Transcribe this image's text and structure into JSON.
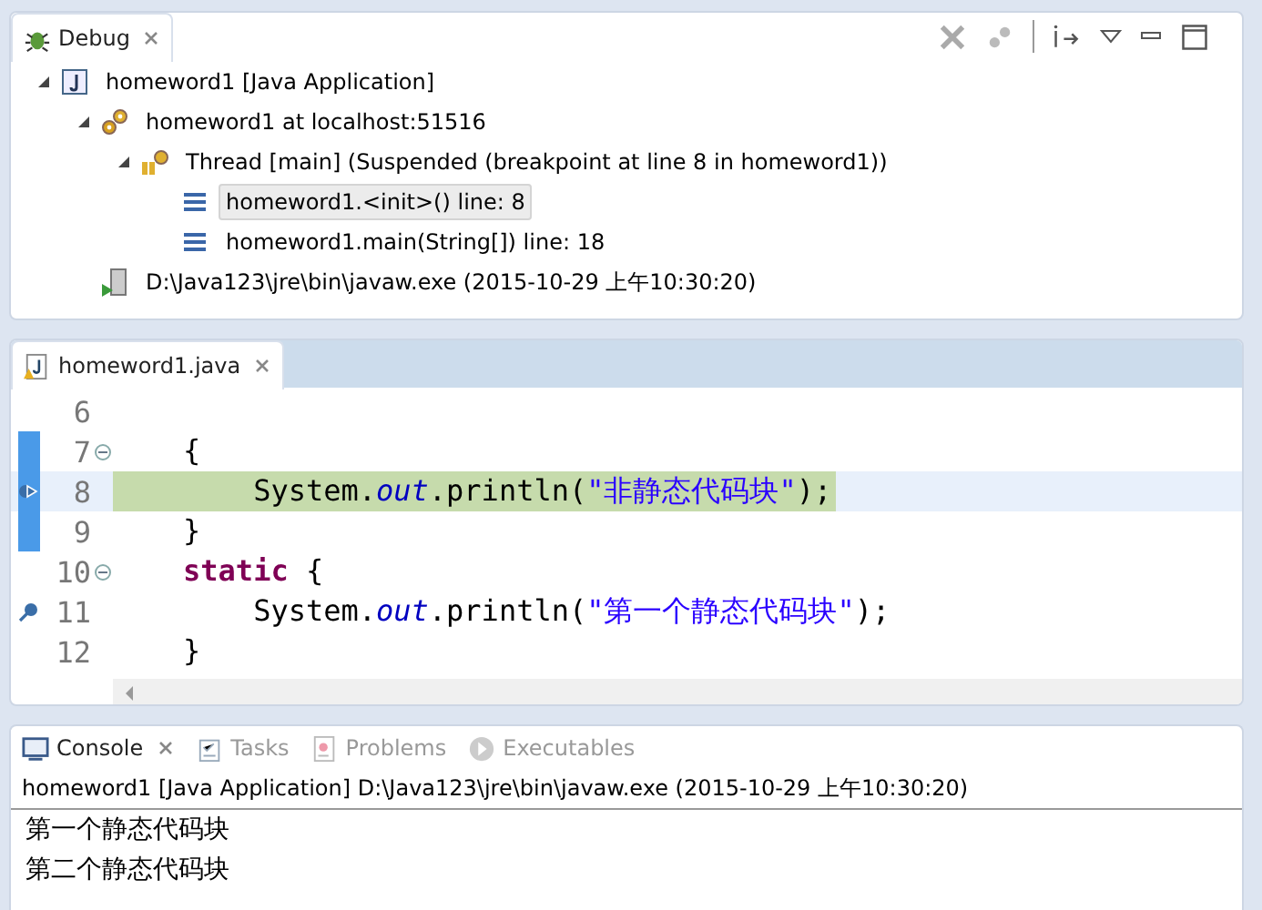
{
  "debug_view": {
    "tab": {
      "label": "Debug",
      "selected": true
    },
    "tree": [
      {
        "kind": "launch",
        "label": "homeword1 [Java Application]",
        "expanded": true,
        "children": [
          {
            "kind": "target",
            "label": "homeword1 at localhost:51516",
            "expanded": true,
            "children": [
              {
                "kind": "thread",
                "label": "Thread [main] (Suspended (breakpoint at line 8 in homeword1))",
                "expanded": true,
                "children": [
                  {
                    "kind": "frame",
                    "label": "homeword1.<init>() line: 8",
                    "selected": true
                  },
                  {
                    "kind": "frame",
                    "label": "homeword1.main(String[]) line: 18",
                    "selected": false
                  }
                ]
              }
            ]
          },
          {
            "kind": "process",
            "label": "D:\\Java123\\jre\\bin\\javaw.exe (2015-10-29 上午10:30:20)"
          }
        ]
      }
    ]
  },
  "editor": {
    "tab": {
      "label": "homeword1.java",
      "selected": true
    },
    "lines": [
      {
        "number": "6",
        "current": false,
        "in_range": false,
        "foldable": false,
        "breakpoint": false
      },
      {
        "number": "7",
        "tokens": [
          {
            "kind": "plain",
            "text": "    {"
          }
        ],
        "current": false,
        "in_range": true,
        "foldable": true,
        "breakpoint": false
      },
      {
        "number": "8",
        "tokens": [
          {
            "kind": "plain",
            "text": "        System."
          },
          {
            "kind": "field",
            "text": "out"
          },
          {
            "kind": "plain",
            "text": ".println("
          },
          {
            "kind": "string",
            "text": "\"非静态代码块\""
          },
          {
            "kind": "plain",
            "text": ");"
          }
        ],
        "current": true,
        "in_range": true,
        "foldable": false,
        "breakpoint": false
      },
      {
        "number": "9",
        "tokens": [
          {
            "kind": "plain",
            "text": "    }"
          }
        ],
        "current": false,
        "in_range": true,
        "foldable": false,
        "breakpoint": false
      },
      {
        "number": "10",
        "tokens": [
          {
            "kind": "keyword",
            "text": "    static"
          },
          {
            "kind": "plain",
            "text": " {"
          }
        ],
        "current": false,
        "in_range": false,
        "foldable": true,
        "breakpoint": false
      },
      {
        "number": "11",
        "tokens": [
          {
            "kind": "plain",
            "text": "        System."
          },
          {
            "kind": "field",
            "text": "out"
          },
          {
            "kind": "plain",
            "text": ".println("
          },
          {
            "kind": "string",
            "text": "\"第一个静态代码块\""
          },
          {
            "kind": "plain",
            "text": ");"
          }
        ],
        "current": false,
        "in_range": false,
        "foldable": false,
        "breakpoint": true
      },
      {
        "number": "12",
        "tokens": [
          {
            "kind": "plain",
            "text": "    }"
          }
        ],
        "current": false,
        "in_range": false,
        "foldable": false,
        "breakpoint": false
      }
    ]
  },
  "console_view": {
    "tabs": [
      {
        "kind": "console",
        "label": "Console",
        "selected": true
      },
      {
        "kind": "tasks",
        "label": "Tasks",
        "selected": false
      },
      {
        "kind": "problems",
        "label": "Problems",
        "selected": false
      },
      {
        "kind": "executables",
        "label": "Executables",
        "selected": false
      }
    ],
    "header": "homeword1 [Java Application] D:\\Java123\\jre\\bin\\javaw.exe (2015-10-29 上午10:30:20)",
    "output": [
      "第一个静态代码块",
      "第二个静态代码块"
    ]
  }
}
